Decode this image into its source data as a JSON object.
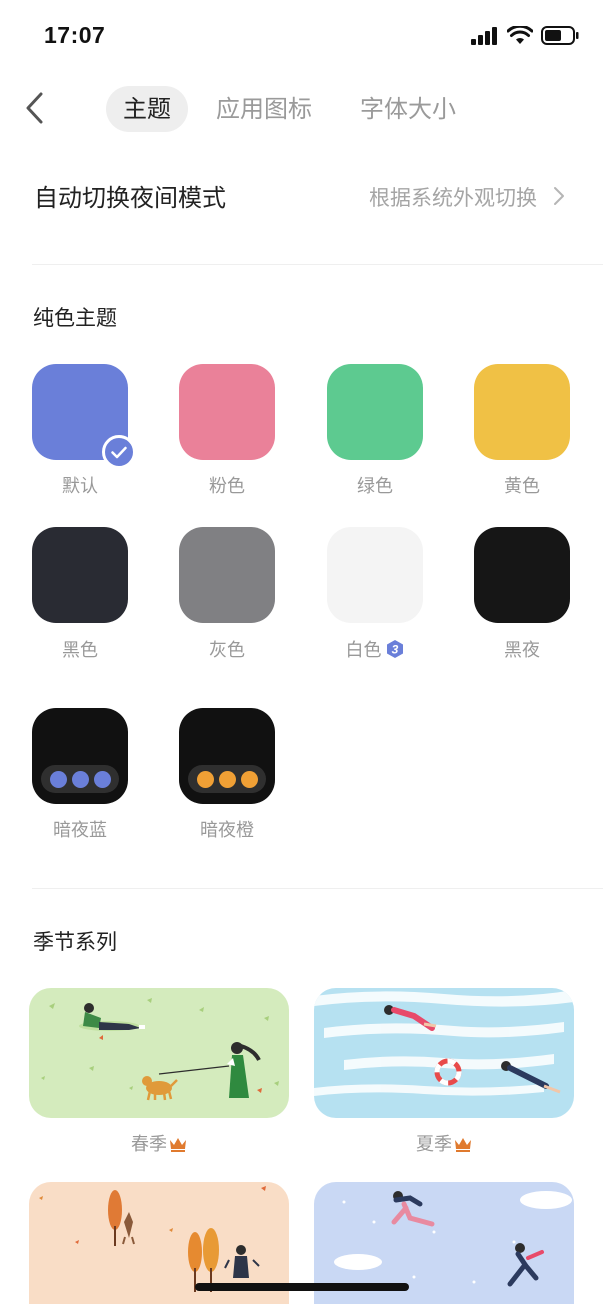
{
  "status_bar": {
    "time": "17:07"
  },
  "nav": {
    "tabs": [
      {
        "label": "主题",
        "active": true
      },
      {
        "label": "应用图标",
        "active": false
      },
      {
        "label": "字体大小",
        "active": false
      }
    ]
  },
  "auto_night": {
    "title": "自动切换夜间模式",
    "value": "根据系统外观切换"
  },
  "solid_section": {
    "title": "纯色主题",
    "themes": [
      {
        "label": "默认",
        "color": "#6a7fd9",
        "selected": true
      },
      {
        "label": "粉色",
        "color": "#ea8199"
      },
      {
        "label": "绿色",
        "color": "#5dca90"
      },
      {
        "label": "黄色",
        "color": "#f0c145"
      },
      {
        "label": "黑色",
        "color": "#292b33"
      },
      {
        "label": "灰色",
        "color": "#808083"
      },
      {
        "label": "白色",
        "color": "#f4f4f4",
        "badge": "3",
        "badge_color": "#6a7fd9"
      },
      {
        "label": "黑夜",
        "color": "#161616"
      },
      {
        "label": "暗夜蓝",
        "color": "#111111",
        "dot_color": "#6a7fd9"
      },
      {
        "label": "暗夜橙",
        "color": "#111111",
        "dot_color": "#f0a035"
      }
    ]
  },
  "season_section": {
    "title": "季节系列",
    "items": [
      {
        "label": "春季",
        "premium": true,
        "bg": "#d4ebbd"
      },
      {
        "label": "夏季",
        "premium": true,
        "bg": "#b6e1f1"
      },
      {
        "label": "",
        "premium": false,
        "bg": "#f9ddc6"
      },
      {
        "label": "",
        "premium": false,
        "bg": "#c9d8f4"
      }
    ]
  },
  "accent_color": "#6a7fd9",
  "crown_color": "#e07a2e"
}
